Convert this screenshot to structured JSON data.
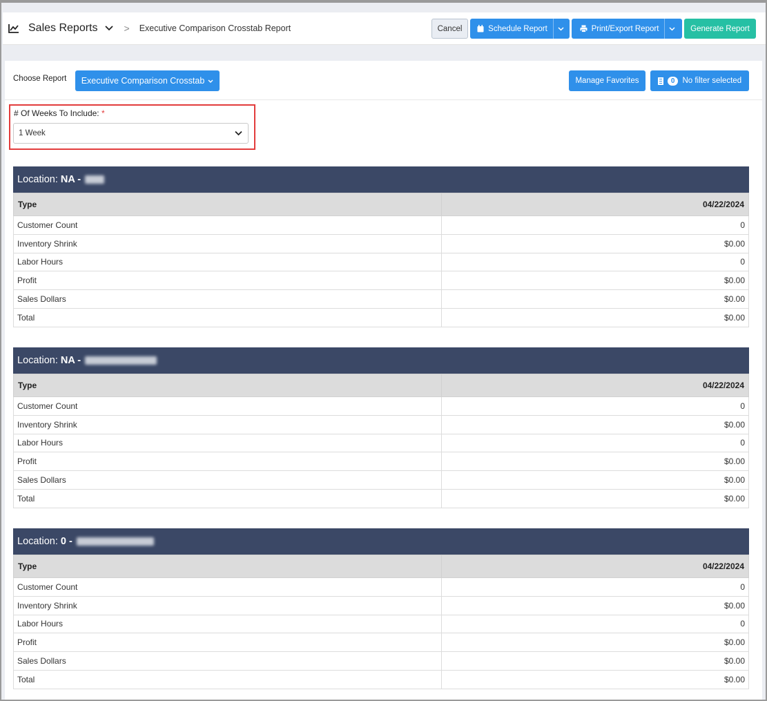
{
  "header": {
    "title": "Sales Reports",
    "subtitle": "Executive Comparison Crosstab Report",
    "separator": ">",
    "buttons": {
      "cancel": "Cancel",
      "schedule": "Schedule Report",
      "print": "Print/Export Report",
      "generate": "Generate Report"
    }
  },
  "controls": {
    "choose_label": "Choose Report",
    "report_selected": "Executive Comparison Crosstab",
    "manage_favorites": "Manage Favorites",
    "filter_count": "0",
    "filter_label": "No filter selected"
  },
  "weeks": {
    "label": "# Of Weeks To Include:",
    "required_mark": "*",
    "value": "1 Week"
  },
  "locations": [
    {
      "prefix": "Location:",
      "code": "NA -",
      "type_header": "Type",
      "date_header": "04/22/2024",
      "rows": [
        {
          "type": "Customer Count",
          "value": "0"
        },
        {
          "type": "Inventory Shrink",
          "value": "$0.00"
        },
        {
          "type": "Labor Hours",
          "value": "0"
        },
        {
          "type": "Profit",
          "value": "$0.00"
        },
        {
          "type": "Sales Dollars",
          "value": "$0.00"
        },
        {
          "type": "Total",
          "value": "$0.00"
        }
      ]
    },
    {
      "prefix": "Location:",
      "code": "NA -",
      "type_header": "Type",
      "date_header": "04/22/2024",
      "rows": [
        {
          "type": "Customer Count",
          "value": "0"
        },
        {
          "type": "Inventory Shrink",
          "value": "$0.00"
        },
        {
          "type": "Labor Hours",
          "value": "0"
        },
        {
          "type": "Profit",
          "value": "$0.00"
        },
        {
          "type": "Sales Dollars",
          "value": "$0.00"
        },
        {
          "type": "Total",
          "value": "$0.00"
        }
      ]
    },
    {
      "prefix": "Location:",
      "code": "0 -",
      "type_header": "Type",
      "date_header": "04/22/2024",
      "rows": [
        {
          "type": "Customer Count",
          "value": "0"
        },
        {
          "type": "Inventory Shrink",
          "value": "$0.00"
        },
        {
          "type": "Labor Hours",
          "value": "0"
        },
        {
          "type": "Profit",
          "value": "$0.00"
        },
        {
          "type": "Sales Dollars",
          "value": "$0.00"
        },
        {
          "type": "Total",
          "value": "$0.00"
        }
      ]
    }
  ],
  "colors": {
    "primary": "#2f90ea",
    "success": "#26c0a4",
    "location_header": "#3b4866",
    "highlight": "#e23b3b"
  }
}
